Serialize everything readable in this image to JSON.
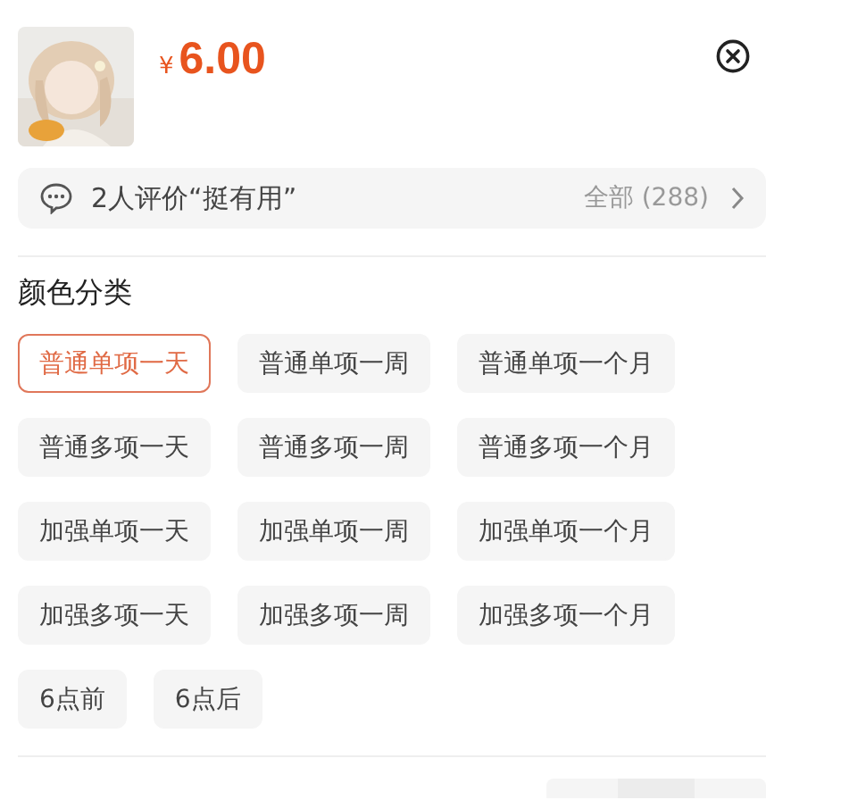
{
  "product": {
    "kind": "picture",
    "currency": "¥",
    "price": "6.00"
  },
  "review_bar": {
    "text": "2人评价“挺有用”",
    "link": "全部 (288)"
  },
  "option_group": {
    "title": "颜色分类",
    "options": [
      {
        "label": "普通单项一天",
        "selected": true
      },
      {
        "label": "普通单项一周",
        "selected": false
      },
      {
        "label": "普通单项一个月",
        "selected": false
      },
      {
        "label": "普通多项一天",
        "selected": false
      },
      {
        "label": "普通多项一周",
        "selected": false
      },
      {
        "label": "普通多项一个月",
        "selected": false
      },
      {
        "label": "加强单项一天",
        "selected": false
      },
      {
        "label": "加强单项一周",
        "selected": false
      },
      {
        "label": "加强单项一个月",
        "selected": false
      },
      {
        "label": "加强多项一天",
        "selected": false
      },
      {
        "label": "加强多项一周",
        "selected": false
      },
      {
        "label": "加强多项一个月",
        "selected": false
      },
      {
        "label": "6点前",
        "selected": false
      },
      {
        "label": "6点后",
        "selected": false
      }
    ]
  }
}
